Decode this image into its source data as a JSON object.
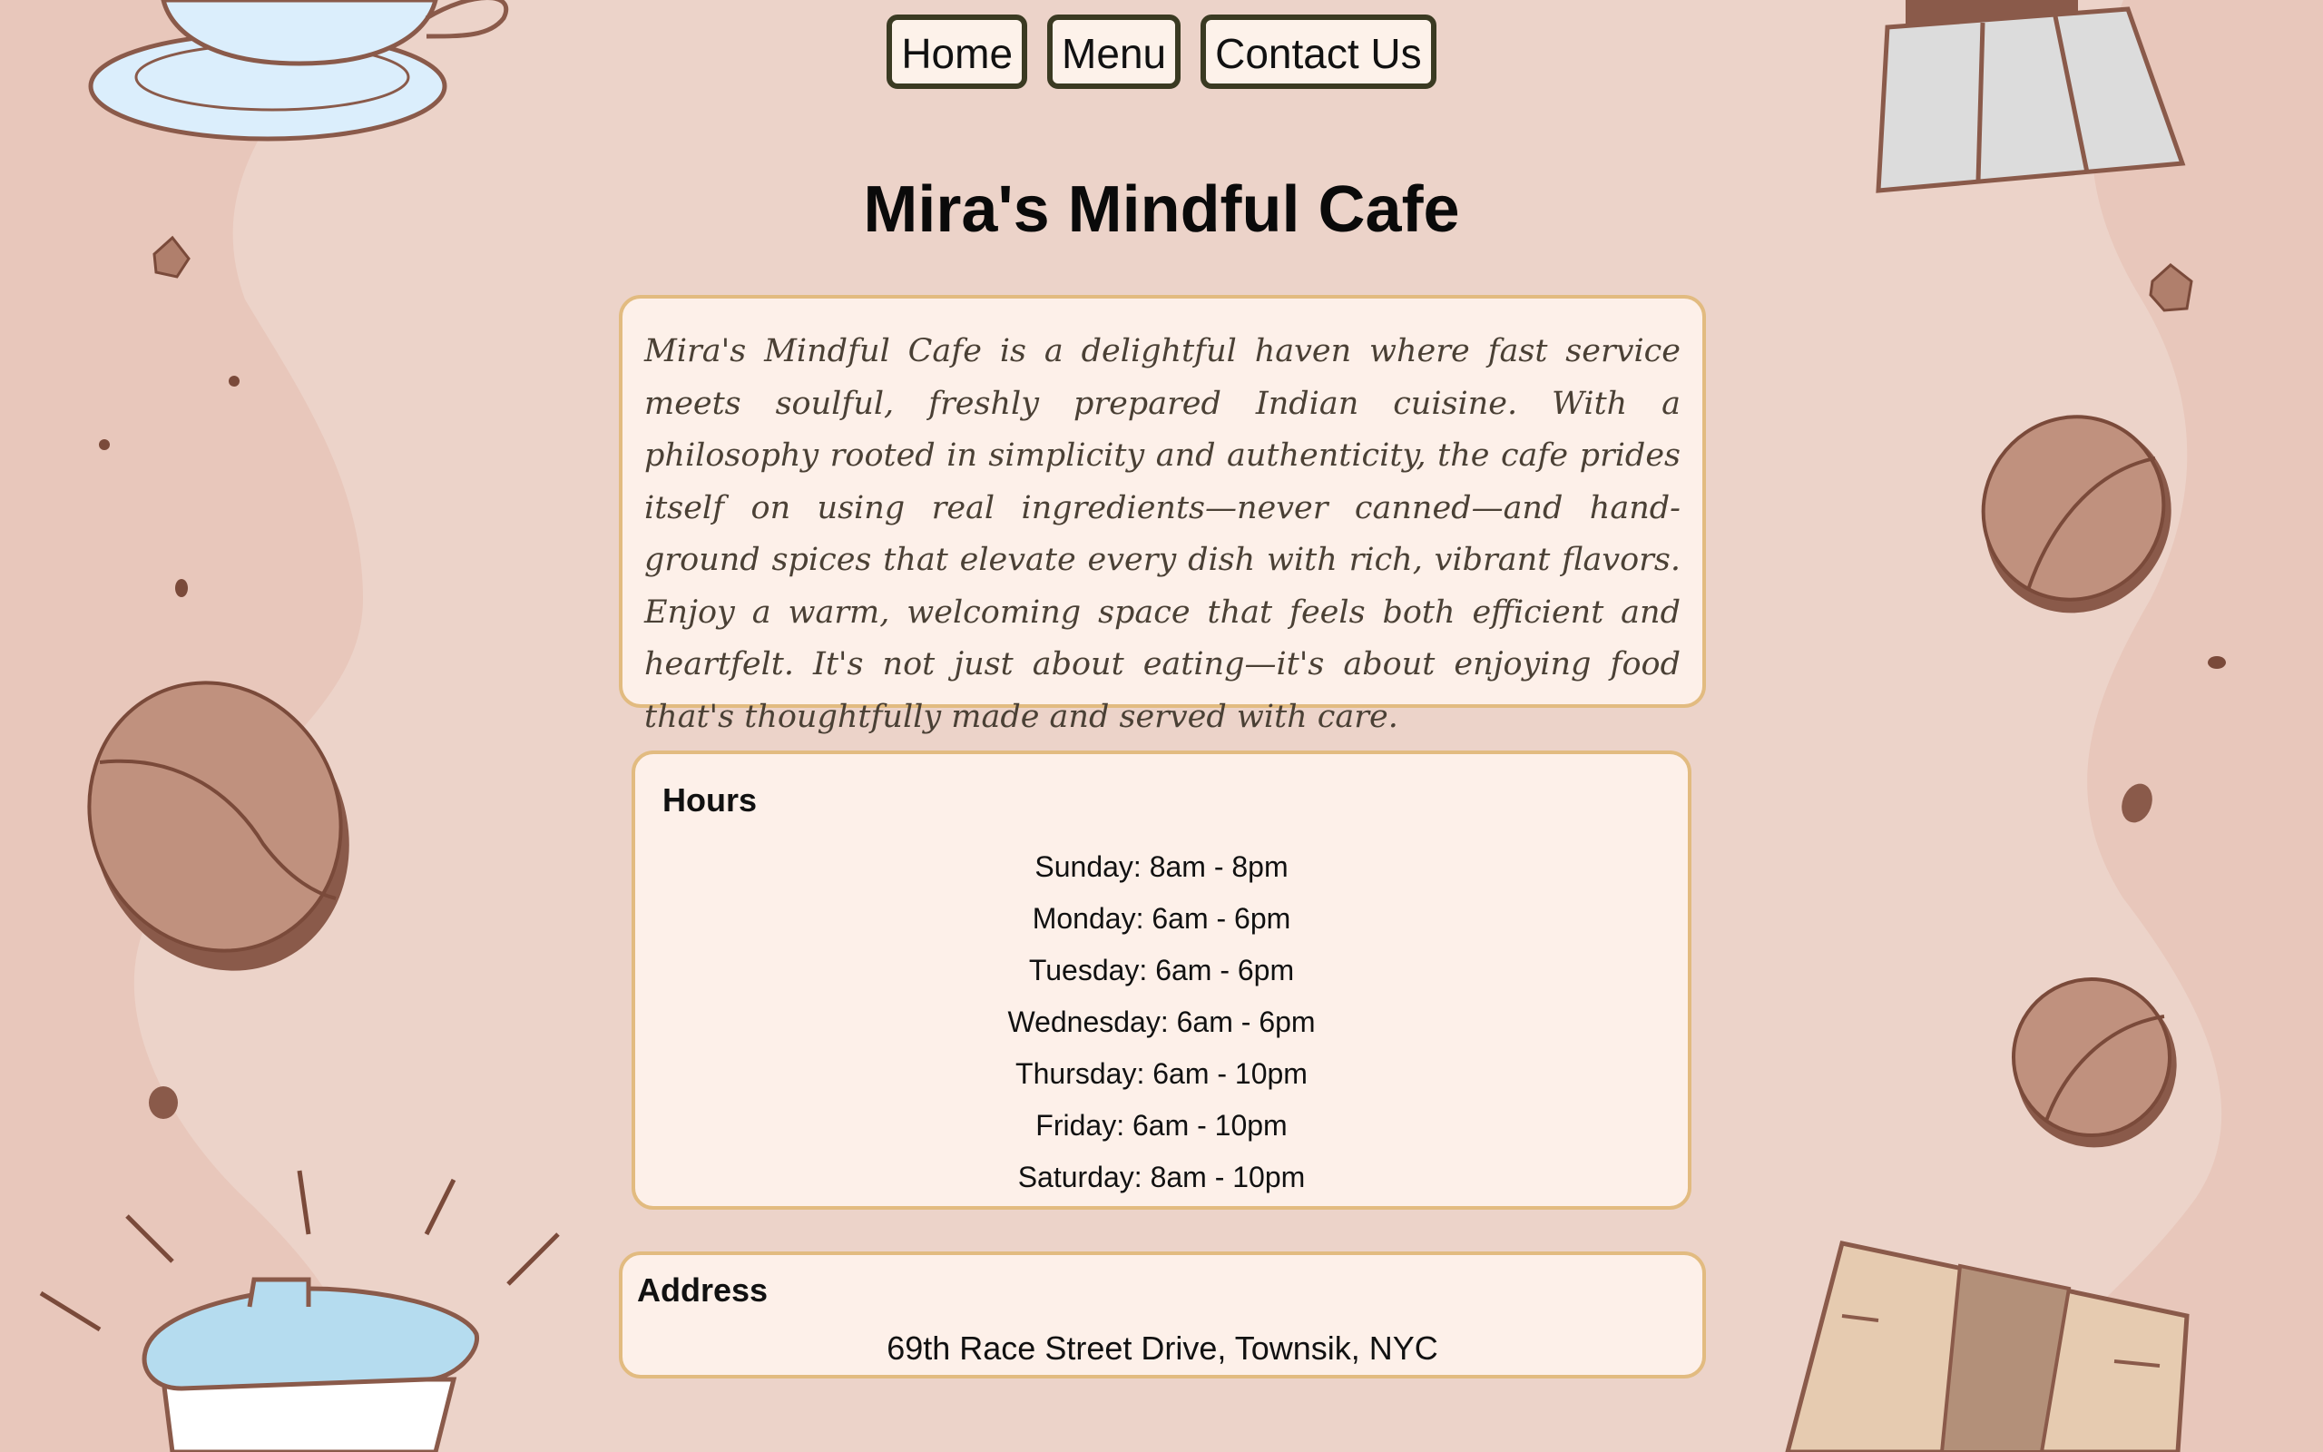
{
  "nav": {
    "home_label": "Home",
    "menu_label": "Menu",
    "contact_label": "Contact Us"
  },
  "page_title": "Mira's Mindful Cafe",
  "intro": {
    "text": "Mira's Mindful Cafe is a delightful haven where fast service meets soulful, freshly prepared Indian cuisine. With a philosophy rooted in simplicity and authenticity, the cafe prides itself on using real ingredients—never canned—and hand-ground spices that elevate every dish with rich, vibrant flavors. Enjoy a warm, welcoming space that feels both efficient and heartfelt. It's not just about eating—it's about enjoying food that's thoughtfully made and served with care."
  },
  "hours": {
    "heading": "Hours",
    "days": [
      "Sunday: 8am - 8pm",
      "Monday: 6am - 6pm",
      "Tuesday: 6am - 6pm",
      "Wednesday: 6am - 6pm",
      "Thursday: 6am - 10pm",
      "Friday: 6am - 10pm",
      "Saturday: 8am - 10pm"
    ]
  },
  "address": {
    "heading": "Address",
    "text": "69th Race Street Drive, Townsik, NYC"
  },
  "colors": {
    "background": "#e8c7bb",
    "card_background": "#fdf0e9",
    "card_border": "#e2bb80",
    "nav_border": "#3a3a22"
  },
  "decorations": [
    "coffee-cup-icon",
    "coffee-bean-icon",
    "french-press-icon",
    "takeaway-cup-icon",
    "coffee-bag-icon"
  ]
}
